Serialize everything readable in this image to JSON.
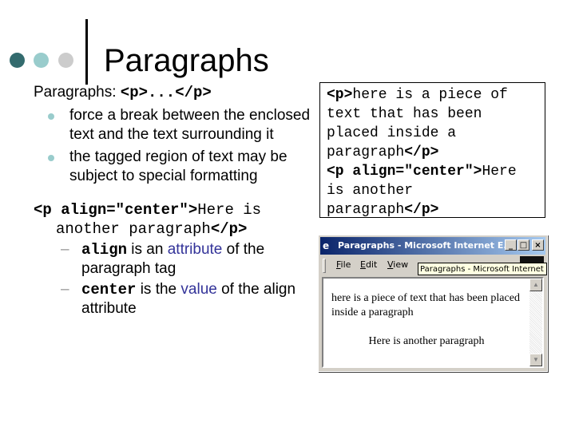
{
  "slide": {
    "title": "Paragraphs",
    "intro_label": "Paragraphs: ",
    "intro_code": "<p>...</p>",
    "bullets": [
      "force a break between the enclosed text and the text surrounding it",
      "the tagged region of text may be subject to special formatting"
    ],
    "code_example": {
      "open_tag": "<p align=\"center\">",
      "content_line1": "Here is",
      "content_line2": "another paragraph",
      "close_tag": "</p>"
    },
    "sub_bullets": [
      {
        "code": "align",
        "before": " is an ",
        "keyword": "attribute",
        "after": " of the paragraph tag"
      },
      {
        "code": "center",
        "before": " is the ",
        "keyword": "value",
        "after": " of the align attribute"
      }
    ],
    "colors": {
      "accent_dark": "#336b6e",
      "accent_light": "#99cccc",
      "accent_gray": "#cccccc",
      "keyword": "#333399"
    }
  },
  "code_box": {
    "line1_tag": "<p>",
    "line1_text": "here is a piece of",
    "line2": "text that has been",
    "line3": "placed inside a",
    "line4_text": "paragraph",
    "line4_tag": "</p>",
    "line5_tag": "<p align=\"center\">",
    "line5_text": "Here",
    "line6": "is another",
    "line7_text": "paragraph",
    "line7_tag": "</p>"
  },
  "browser": {
    "title": "Paragraphs - Microsoft Internet E...",
    "menus": [
      {
        "accel": "F",
        "rest": "ile"
      },
      {
        "accel": "E",
        "rest": "dit"
      },
      {
        "accel": "V",
        "rest": "iew"
      }
    ],
    "chevron": "»",
    "tooltip": "Paragraphs - Microsoft Internet E",
    "paragraph1": "here is a piece of text that has been placed inside a paragraph",
    "paragraph2": "Here is another paragraph",
    "buttons": {
      "minimize": "_",
      "maximize": "□",
      "close": "×"
    }
  }
}
